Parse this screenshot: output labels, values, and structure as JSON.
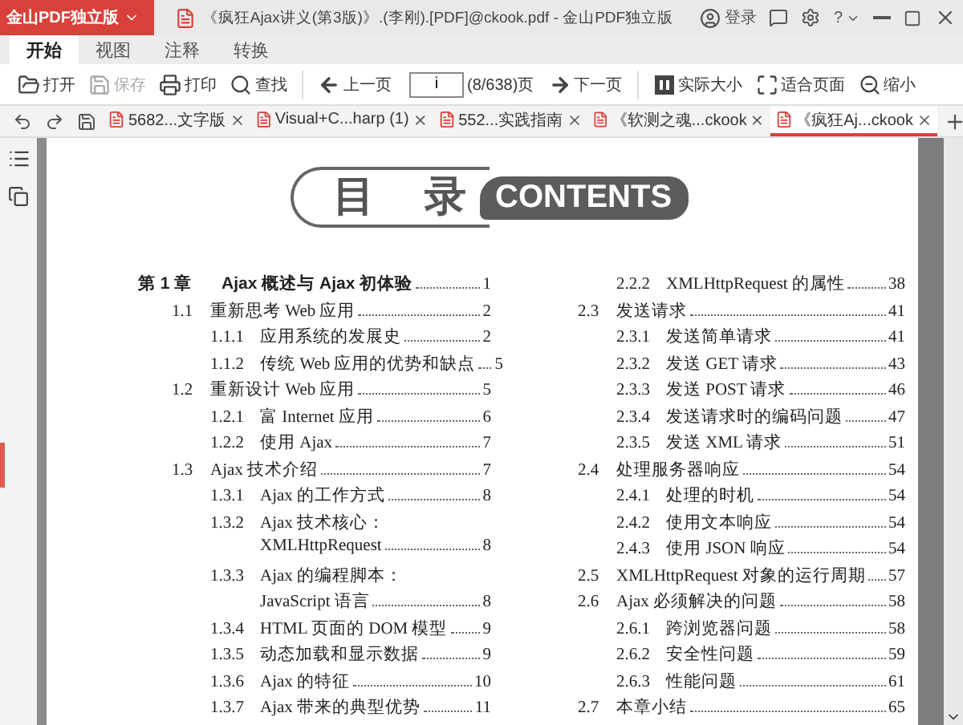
{
  "app": {
    "name": "金山PDF独立版"
  },
  "window": {
    "title": "《疯狂Ajax讲义(第3版)》.(李刚).[PDF]@ckook.pdf - 金山PDF独立版",
    "login": "登录",
    "help": "?"
  },
  "ribbon_tabs": [
    {
      "label": "开始",
      "selected": true
    },
    {
      "label": "视图",
      "selected": false
    },
    {
      "label": "注释",
      "selected": false
    },
    {
      "label": "转换",
      "selected": false
    }
  ],
  "toolbar": {
    "file_buttons": [
      {
        "label": "打开",
        "disabled": false
      },
      {
        "label": "保存",
        "disabled": true
      },
      {
        "label": "打印",
        "disabled": false
      },
      {
        "label": "查找",
        "disabled": false
      }
    ],
    "prev": "上一页",
    "page_input": "i",
    "page_count": "(8/638)页",
    "next": "下一页",
    "view_buttons": [
      {
        "label": "实际大小"
      },
      {
        "label": "适合页面"
      },
      {
        "label": "缩小"
      }
    ]
  },
  "doc_tabs": [
    {
      "label": "5682...文字版",
      "selected": false
    },
    {
      "label": "Visual+C...harp (1)",
      "selected": false
    },
    {
      "label": "552...实践指南",
      "selected": false
    },
    {
      "label": "《软测之魂...ckook",
      "selected": false
    },
    {
      "label": "《疯狂Aj...ckook",
      "selected": true
    }
  ],
  "page": {
    "heading": {
      "title": "目 录",
      "badge": "CONTENTS"
    },
    "columns": [
      {
        "entries": [
          {
            "number": "第 1 章",
            "title": [
              "Ajax 概述与 Ajax 初体验"
            ],
            "page": "1",
            "children": [
              {
                "number": "1.1",
                "title": [
                  "重新思考 Web 应用"
                ],
                "page": "2",
                "children": [
                  {
                    "number": "1.1.1",
                    "title": [
                      "应用系统的发展史"
                    ],
                    "page": "2"
                  },
                  {
                    "number": "1.1.2",
                    "title": [
                      "传统 Web 应用的优势和缺点"
                    ],
                    "page": "5"
                  }
                ]
              },
              {
                "number": "1.2",
                "title": [
                  "重新设计 Web 应用"
                ],
                "page": "5",
                "children": [
                  {
                    "number": "1.2.1",
                    "title": [
                      "富 Internet 应用"
                    ],
                    "page": "6"
                  },
                  {
                    "number": "1.2.2",
                    "title": [
                      "使用 Ajax"
                    ],
                    "page": "7"
                  }
                ]
              },
              {
                "number": "1.3",
                "title": [
                  "Ajax 技术介绍"
                ],
                "page": "7",
                "children": [
                  {
                    "number": "1.3.1",
                    "title": [
                      "Ajax 的工作方式"
                    ],
                    "page": "8"
                  },
                  {
                    "number": "1.3.2",
                    "title": [
                      "Ajax 技术核心：",
                      "XMLHttpRequest"
                    ],
                    "page": "8"
                  },
                  {
                    "number": "1.3.3",
                    "title": [
                      "Ajax 的编程脚本：",
                      "JavaScript 语言"
                    ],
                    "page": "8"
                  },
                  {
                    "number": "1.3.4",
                    "title": [
                      "HTML 页面的 DOM 模型"
                    ],
                    "page": "9"
                  },
                  {
                    "number": "1.3.5",
                    "title": [
                      "动态加载和显示数据"
                    ],
                    "page": "9"
                  },
                  {
                    "number": "1.3.6",
                    "title": [
                      "Ajax 的特征"
                    ],
                    "page": "10"
                  },
                  {
                    "number": "1.3.7",
                    "title": [
                      "Ajax 带来的典型优势"
                    ],
                    "page": "11"
                  }
                ]
              }
            ]
          }
        ]
      },
      {
        "continued": [
          {
            "number": "2.2.2",
            "title": [
              "XMLHttpRequest 的属性"
            ],
            "page": "38"
          }
        ],
        "entries": [
          {
            "number": "2.3",
            "title": [
              "发送请求"
            ],
            "page": "41",
            "children": [
              {
                "number": "2.3.1",
                "title": [
                  "发送简单请求"
                ],
                "page": "41"
              },
              {
                "number": "2.3.2",
                "title": [
                  "发送 GET 请求"
                ],
                "page": "43"
              },
              {
                "number": "2.3.3",
                "title": [
                  "发送 POST 请求"
                ],
                "page": "46"
              },
              {
                "number": "2.3.4",
                "title": [
                  "发送请求时的编码问题"
                ],
                "page": "47"
              },
              {
                "number": "2.3.5",
                "title": [
                  "发送 XML 请求"
                ],
                "page": "51"
              }
            ]
          },
          {
            "number": "2.4",
            "title": [
              "处理服务器响应"
            ],
            "page": "54",
            "children": [
              {
                "number": "2.4.1",
                "title": [
                  "处理的时机"
                ],
                "page": "54"
              },
              {
                "number": "2.4.2",
                "title": [
                  "使用文本响应"
                ],
                "page": "54"
              },
              {
                "number": "2.4.3",
                "title": [
                  "使用 JSON 响应"
                ],
                "page": "54"
              }
            ]
          },
          {
            "number": "2.5",
            "title": [
              "XMLHttpRequest 对象的运行周期"
            ],
            "page": "57"
          },
          {
            "number": "2.6",
            "title": [
              "Ajax 必须解决的问题"
            ],
            "page": "58",
            "children": [
              {
                "number": "2.6.1",
                "title": [
                  "跨浏览器问题"
                ],
                "page": "58"
              },
              {
                "number": "2.6.2",
                "title": [
                  "安全性问题"
                ],
                "page": "59"
              },
              {
                "number": "2.6.3",
                "title": [
                  "性能问题"
                ],
                "page": "61"
              }
            ]
          },
          {
            "number": "2.7",
            "title": [
              "本章小结"
            ],
            "page": "65"
          }
        ]
      }
    ]
  }
}
